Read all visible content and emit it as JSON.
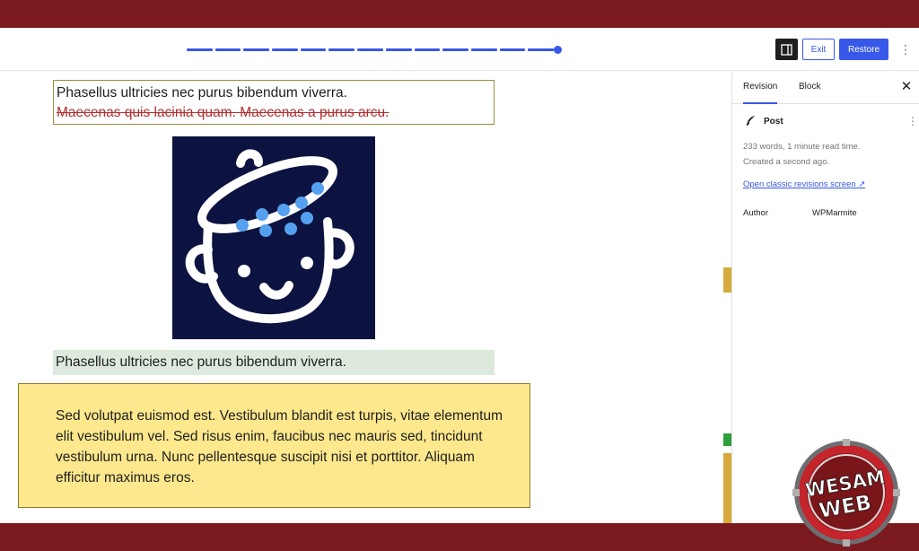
{
  "colors": {
    "band": "#7b1a1e",
    "accent": "#3858e9",
    "removed_text": "#b32d2e",
    "changed_border": "#9c8f3e",
    "added_bg": "#dde9dd",
    "highlight_bg": "#fde88d",
    "image_bg": "#0c1340",
    "image_dots": "#56a0f0",
    "mark_yellow": "#d5a93a",
    "mark_green": "#2f9e3c"
  },
  "toolbar": {
    "revision_slider": {
      "segments": 13,
      "position": 1.0
    },
    "sidebar_toggle_icon": "sidebar-layout-icon",
    "exit_label": "Exit",
    "restore_label": "Restore",
    "more_icon": "vertical-ellipsis-icon"
  },
  "content": {
    "p1_line1": "Phasellus ultricies nec purus bibendum viverra.",
    "p1_line2_removed": "Maecenas quis lacinia quam. Maecenas a purus arcu.",
    "image_icon": "cooking-pot-logo-icon",
    "p2_added": "Phasellus ultricies nec purus bibendum viverra.",
    "p3": "Sed volutpat euismod est. Vestibulum blandit est turpis, vitae elementum elit vestibulum vel. Sed risus enim, faucibus nec mauris sed, tincidunt vestibulum urna. Nunc pellentesque suscipit nisi et porttitor. Aliquam efficitur maximus eros."
  },
  "sidebar": {
    "tabs": [
      {
        "label": "Revision",
        "active": true
      },
      {
        "label": "Block",
        "active": false
      }
    ],
    "close_icon": "close-icon",
    "post_icon": "feather-pen-icon",
    "post_label": "Post",
    "stats": "233 words, 1 minute read time.",
    "created": "Created a second ago.",
    "classic_link": "Open classic revisions screen ↗",
    "author_label": "Author",
    "author_name": "WPMarmite"
  },
  "watermark": {
    "line1": "WESAM",
    "line2": "WEB"
  }
}
